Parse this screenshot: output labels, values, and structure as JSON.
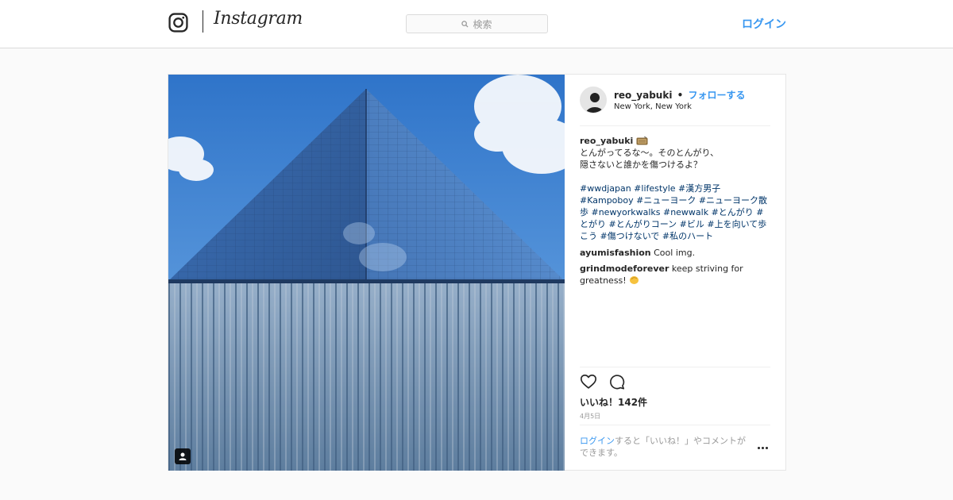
{
  "header": {
    "wordmark": "Instagram",
    "search_placeholder": "検索",
    "login_label": "ログイン"
  },
  "post": {
    "username": "reo_yabuki",
    "separator": "•",
    "follow_label": "フォローする",
    "location": "New York, New York",
    "caption": {
      "user": "reo_yabuki",
      "lines": [
        "とんがってるな〜。そのとんがり、",
        "隠さないと誰かを傷つけるよ？"
      ],
      "hashtags": "#wwdjapan #lifestyle #漢方男子 #Kampoboy #ニューヨーク #ニューヨーク散歩 #newyorkwalks #newwalk #とんがり #とがり #とんがりコーン #ビル #上を向いて歩こう #傷つけないで #私のハート"
    },
    "comments": [
      {
        "user": "ayumisfashion",
        "text": "Cool img."
      },
      {
        "user": "grindmodeforever",
        "text": "keep striving for greatness!"
      }
    ],
    "likes": "いいね！142件",
    "date": "4月5日",
    "login_prompt": {
      "link": "ログイン",
      "text": "すると「いいね！」やコメントができます。"
    }
  },
  "colors": {
    "link": "#3897f0",
    "hashtag": "#003569",
    "muted": "#999999"
  },
  "icons": [
    "instagram-camera-icon",
    "search-icon",
    "user-tag-icon",
    "heart-icon",
    "comment-icon",
    "radio-emoji-icon",
    "clapping-hand-emoji-icon",
    "more-options-icon"
  ]
}
